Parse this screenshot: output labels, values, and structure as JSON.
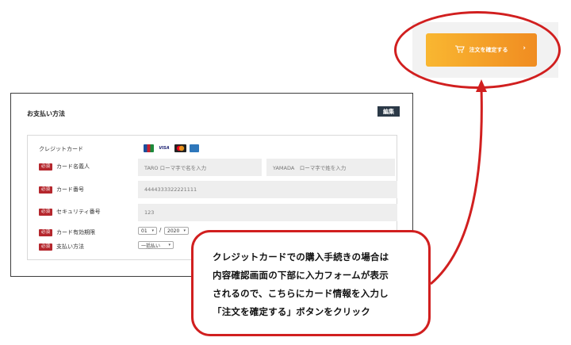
{
  "payment": {
    "title": "お支払い方法",
    "edit_label": "編集",
    "required_label": "必須",
    "credit_card_label": "クレジットカード",
    "card_logos": [
      "JCB",
      "VISA",
      "MC",
      "AMEX"
    ],
    "cardholder": {
      "label": "カード名義人",
      "first_placeholder": "TARO ローマ字で名を入力",
      "last_placeholder": "YAMADA　ローマ字で姓を入力"
    },
    "card_number": {
      "label": "カード番号",
      "value": "4444333322221111"
    },
    "security_code": {
      "label": "セキュリティ番号",
      "value": "123"
    },
    "expiry": {
      "label": "カード有効期限",
      "month": "01",
      "separator": "/",
      "year": "2020"
    },
    "pay_method": {
      "label": "支払い方法",
      "value": "一括払い"
    }
  },
  "confirm": {
    "button_label": "注文を確定する",
    "arrow": "›"
  },
  "callout": {
    "lines": [
      "クレジットカードでの購入手続きの場合は",
      "内容確認画面の下部に入力フォームが表示",
      "されるので、こちらにカード情報を入力し",
      "「注文を確定する」ボタンをクリック"
    ]
  },
  "colors": {
    "accent": "#d11f1f",
    "button_from": "#f9b731",
    "button_to": "#f08c21",
    "required": "#b5272d"
  }
}
